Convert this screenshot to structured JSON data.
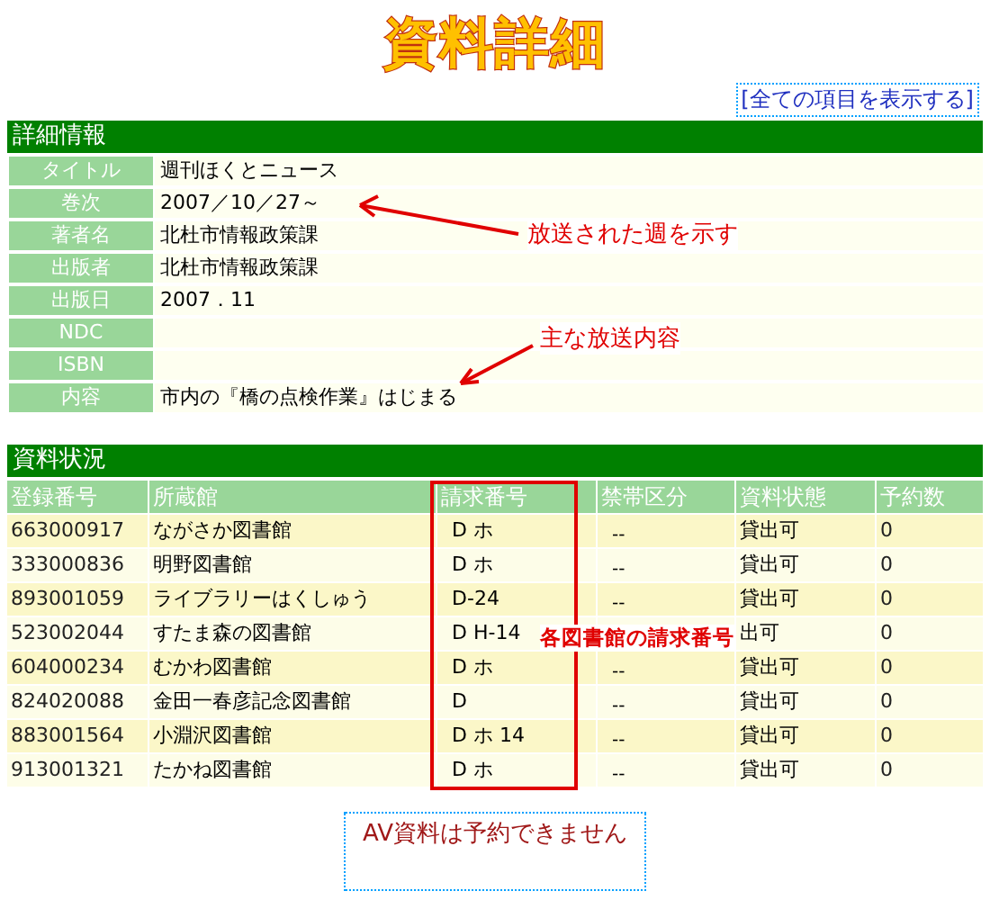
{
  "page_title": "資料詳細",
  "show_all_link": "[全ての項目を表示する]",
  "details": {
    "heading": "詳細情報",
    "rows": [
      {
        "label": "タイトル",
        "value": "週刊ほくとニュース"
      },
      {
        "label": "巻次",
        "value": "2007／10／27～"
      },
      {
        "label": "著者名",
        "value": "北杜市情報政策課"
      },
      {
        "label": "出版者",
        "value": "北杜市情報政策課"
      },
      {
        "label": "出版日",
        "value": "2007．11"
      },
      {
        "label": "NDC"
      },
      {
        "label": "ISBN"
      },
      {
        "label": "内容",
        "value": "市内の『橋の点検作業』はじまる"
      }
    ]
  },
  "holdings": {
    "heading": "資料状況",
    "columns": [
      "登録番号",
      "所蔵館",
      "請求番号",
      "禁帯区分",
      "資料状態",
      "予約数"
    ],
    "rows": [
      [
        "663000917",
        "ながさか図書館",
        "D ホ",
        "--",
        "貸出可",
        "0"
      ],
      [
        "333000836",
        "明野図書館",
        "D ホ",
        "--",
        "貸出可",
        "0"
      ],
      [
        "893001059",
        "ライブラリーはくしゅう",
        "D-24",
        "--",
        "貸出可",
        "0"
      ],
      [
        "523002044",
        "すたま森の図書館",
        "D H-14",
        null,
        "出可",
        "0"
      ],
      [
        "604000234",
        "むかわ図書館",
        "D ホ",
        "--",
        "貸出可",
        "0"
      ],
      [
        "824020088",
        "金田一春彦記念図書館",
        "D",
        "--",
        "貸出可",
        "0"
      ],
      [
        "883001564",
        "小淵沢図書館",
        "D ホ 14",
        "--",
        "貸出可",
        "0"
      ],
      [
        "913001321",
        "たかね図書館",
        "D ホ",
        "--",
        "貸出可",
        "0"
      ]
    ]
  },
  "notice": "AV資料は予約できません",
  "annotations": [
    {
      "kind": "arrow",
      "text": "放送された週を示す"
    },
    {
      "kind": "arrow",
      "text": "主な放送内容"
    },
    {
      "kind": "box",
      "text": "各図書館の請求番号"
    }
  ]
}
